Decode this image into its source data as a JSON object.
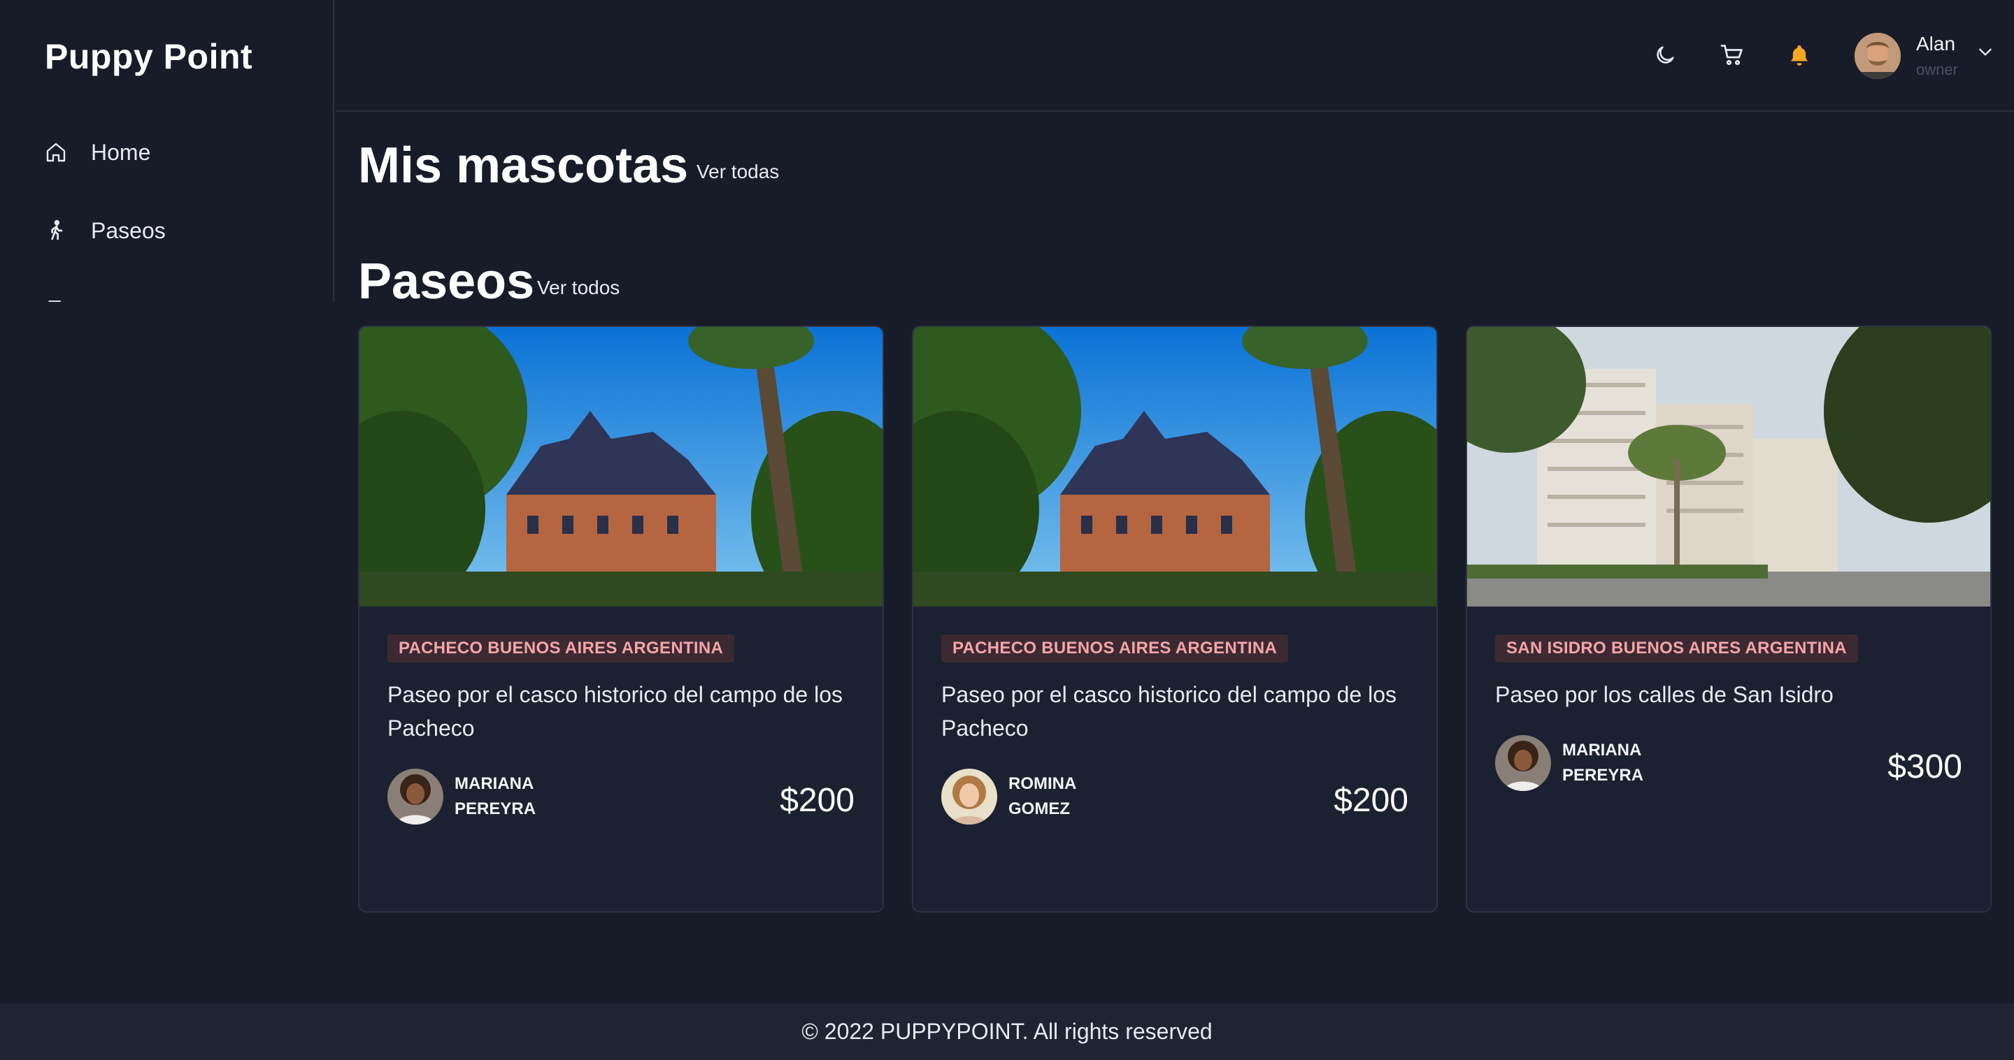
{
  "brand": "Puppy Point",
  "sidebar": {
    "items": [
      {
        "label": "Home",
        "icon": "home-icon"
      },
      {
        "label": "Paseos",
        "icon": "walk-icon"
      }
    ]
  },
  "header": {
    "icons": [
      "moon-icon",
      "cart-icon",
      "bell-icon"
    ],
    "accent_color": "#f5a623",
    "user": {
      "name": "Alan",
      "role": "owner"
    }
  },
  "sections": {
    "mascotas": {
      "title": "Mis mascotas",
      "link": "Ver todas"
    },
    "paseos": {
      "title": "Paseos",
      "link": "Ver todos"
    }
  },
  "cards": [
    {
      "location": "PACHECO BUENOS AIRES ARGENTINA",
      "title": "Paseo por el casco historico del campo de los Pacheco",
      "walker_first": "MARIANA",
      "walker_last": "PEREYRA",
      "price": "$200"
    },
    {
      "location": "PACHECO BUENOS AIRES ARGENTINA",
      "title": "Paseo por el casco historico del campo de los Pacheco",
      "walker_first": "ROMINA",
      "walker_last": "GOMEZ",
      "price": "$200"
    },
    {
      "location": "SAN ISIDRO BUENOS AIRES ARGENTINA",
      "title": "Paseo por los calles de San Isidro",
      "walker_first": "MARIANA",
      "walker_last": "PEREYRA",
      "price": "$300"
    }
  ],
  "footer": "© 2022 PUPPYPOINT. All rights reserved"
}
